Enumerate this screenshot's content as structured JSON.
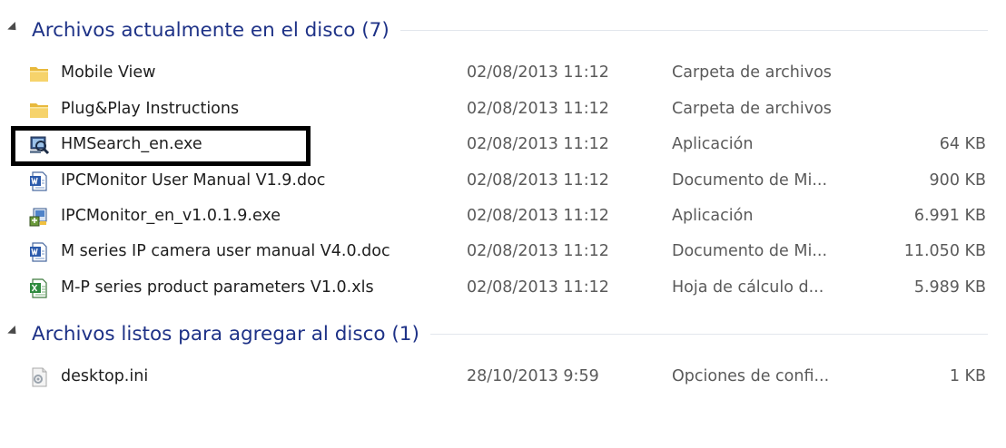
{
  "groups": [
    {
      "title": "Archivos actualmente en el disco (7)",
      "items": [
        {
          "name": "Mobile View",
          "date": "02/08/2013 11:12",
          "type": "Carpeta de archivos",
          "size": "",
          "icon": "folder-icon"
        },
        {
          "name": "Plug&Play Instructions",
          "date": "02/08/2013 11:12",
          "type": "Carpeta de archivos",
          "size": "",
          "icon": "folder-icon"
        },
        {
          "name": "HMSearch_en.exe",
          "date": "02/08/2013 11:12",
          "type": "Aplicación",
          "size": "64 KB",
          "icon": "search-app-icon"
        },
        {
          "name": "IPCMonitor User Manual V1.9.doc",
          "date": "02/08/2013 11:12",
          "type": "Documento de Mi...",
          "size": "900 KB",
          "icon": "word-doc-icon"
        },
        {
          "name": "IPCMonitor_en_v1.0.1.9.exe",
          "date": "02/08/2013 11:12",
          "type": "Aplicación",
          "size": "6.991 KB",
          "icon": "installer-icon"
        },
        {
          "name": "M series IP camera user manual V4.0.doc",
          "date": "02/08/2013 11:12",
          "type": "Documento de Mi...",
          "size": "11.050 KB",
          "icon": "word-doc-icon"
        },
        {
          "name": "M-P series product parameters V1.0.xls",
          "date": "02/08/2013 11:12",
          "type": "Hoja de cálculo d...",
          "size": "5.989 KB",
          "icon": "excel-sheet-icon"
        }
      ]
    },
    {
      "title": "Archivos listos para agregar al disco (1)",
      "items": [
        {
          "name": "desktop.ini",
          "date": "28/10/2013 9:59",
          "type": "Opciones de confi...",
          "size": "1 KB",
          "icon": "settings-file-icon"
        }
      ]
    }
  ],
  "colors": {
    "group_title": "#1e3287",
    "highlight_border": "#000000"
  }
}
